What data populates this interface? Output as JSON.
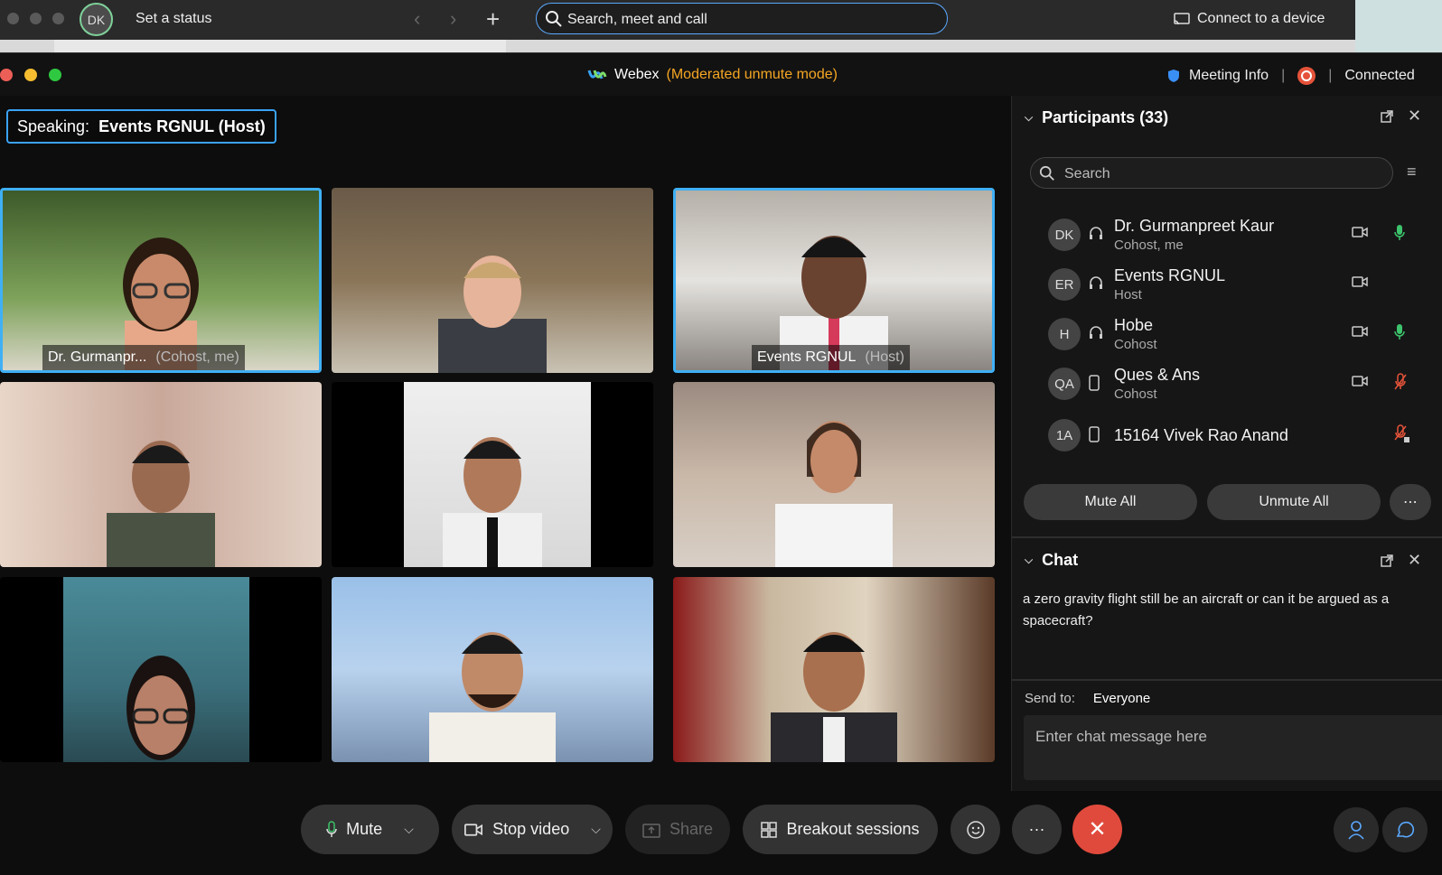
{
  "appbar": {
    "avatar_initials": "DK",
    "status_label": "Set a status",
    "back_glyph": "‹",
    "forward_glyph": "›",
    "new_glyph": "+",
    "search_placeholder": "Search, meet and call",
    "connect_label": "Connect to a device"
  },
  "meeting": {
    "app_name": "Webex",
    "mode": "(Moderated unmute mode)",
    "meeting_info_label": "Meeting Info",
    "connection_status": "Connected"
  },
  "speaking": {
    "prefix": "Speaking:",
    "name": "Events RGNUL (Host)"
  },
  "tiles": [
    {
      "label": "Dr. Gurmanpr...",
      "role": "(Cohost, me)",
      "active": true
    },
    {
      "label": "",
      "role": "",
      "active": false
    },
    {
      "label": "Events RGNUL",
      "role": "(Host)",
      "active": true
    },
    {
      "label": "",
      "role": "",
      "active": false
    },
    {
      "label": "",
      "role": "",
      "active": false
    },
    {
      "label": "",
      "role": "",
      "active": false
    },
    {
      "label": "",
      "role": "",
      "active": false
    },
    {
      "label": "",
      "role": "",
      "active": false
    },
    {
      "label": "",
      "role": "",
      "active": false
    }
  ],
  "participants": {
    "title": "Participants (33)",
    "search_placeholder": "Search",
    "list": [
      {
        "initials": "DK",
        "name": "Dr. Gurmanpreet Kaur",
        "role": "Cohost, me",
        "device": "headset",
        "camera": true,
        "mic": "on"
      },
      {
        "initials": "ER",
        "name": "Events RGNUL",
        "role": "Host",
        "device": "headset",
        "camera": true,
        "mic": "none"
      },
      {
        "initials": "H",
        "name": "Hobe",
        "role": "Cohost",
        "device": "headset",
        "camera": true,
        "mic": "on"
      },
      {
        "initials": "QA",
        "name": "Ques & Ans",
        "role": "Cohost",
        "device": "phone",
        "camera": true,
        "mic": "muted"
      },
      {
        "initials": "1A",
        "name": "15164 Vivek Rao Anand",
        "role": "",
        "device": "phone",
        "camera": false,
        "mic": "locked"
      }
    ],
    "mute_all_label": "Mute All",
    "unmute_all_label": "Unmute All",
    "more_glyph": "⋯"
  },
  "chat": {
    "title": "Chat",
    "message_line1": "a zero gravity flight still be an aircraft or can it be argued as a",
    "message_line2": "spacecraft?",
    "send_to_label": "Send to:",
    "send_to_value": "Everyone",
    "input_placeholder": "Enter chat message here"
  },
  "controls": {
    "mute_label": "Mute",
    "stop_video_label": "Stop video",
    "share_label": "Share",
    "breakout_label": "Breakout sessions",
    "more_glyph": "···",
    "leave_glyph": "✕"
  },
  "colors": {
    "accent_blue": "#3aa3f5",
    "mode_orange": "#f5a623",
    "leave_red": "#e04a3c",
    "mic_green": "#3cc36b",
    "muted_red": "#e5533a"
  }
}
